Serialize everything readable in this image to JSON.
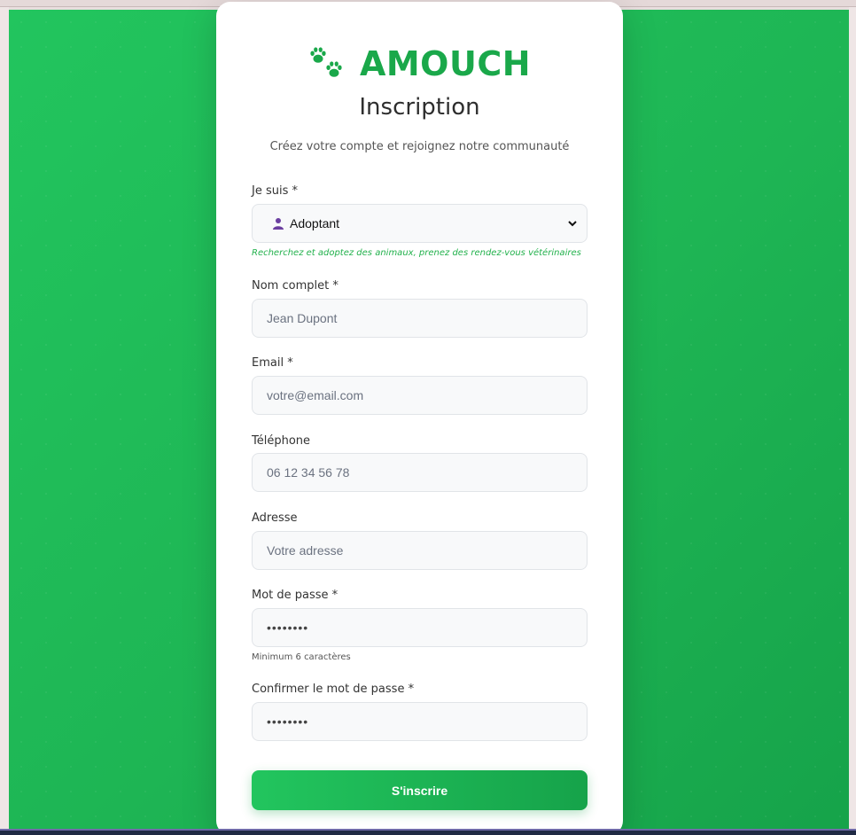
{
  "brand": {
    "name": "AMOUCH",
    "icon": "paw-icon"
  },
  "header": {
    "title": "Inscription",
    "subtitle": "Créez votre compte et rejoignez notre communauté"
  },
  "form": {
    "role": {
      "label": "Je suis *",
      "selected": "Adoptant",
      "icon": "user-icon",
      "hint": "Recherchez et adoptez des animaux, prenez des rendez-vous vétérinaires"
    },
    "name": {
      "label": "Nom complet *",
      "placeholder": "Jean Dupont"
    },
    "email": {
      "label": "Email *",
      "placeholder": "votre@email.com"
    },
    "phone": {
      "label": "Téléphone",
      "placeholder": "06 12 34 56 78"
    },
    "address": {
      "label": "Adresse",
      "placeholder": "Votre adresse"
    },
    "password": {
      "label": "Mot de passe *",
      "value": "••••••••",
      "helper": "Minimum 6 caractères"
    },
    "confirm": {
      "label": "Confirmer le mot de passe *",
      "value": "••••••••"
    },
    "submit_label": "S'inscrire"
  },
  "colors": {
    "accent": "#22c55e",
    "accent_dark": "#16a34a",
    "background": "#1eb554"
  }
}
